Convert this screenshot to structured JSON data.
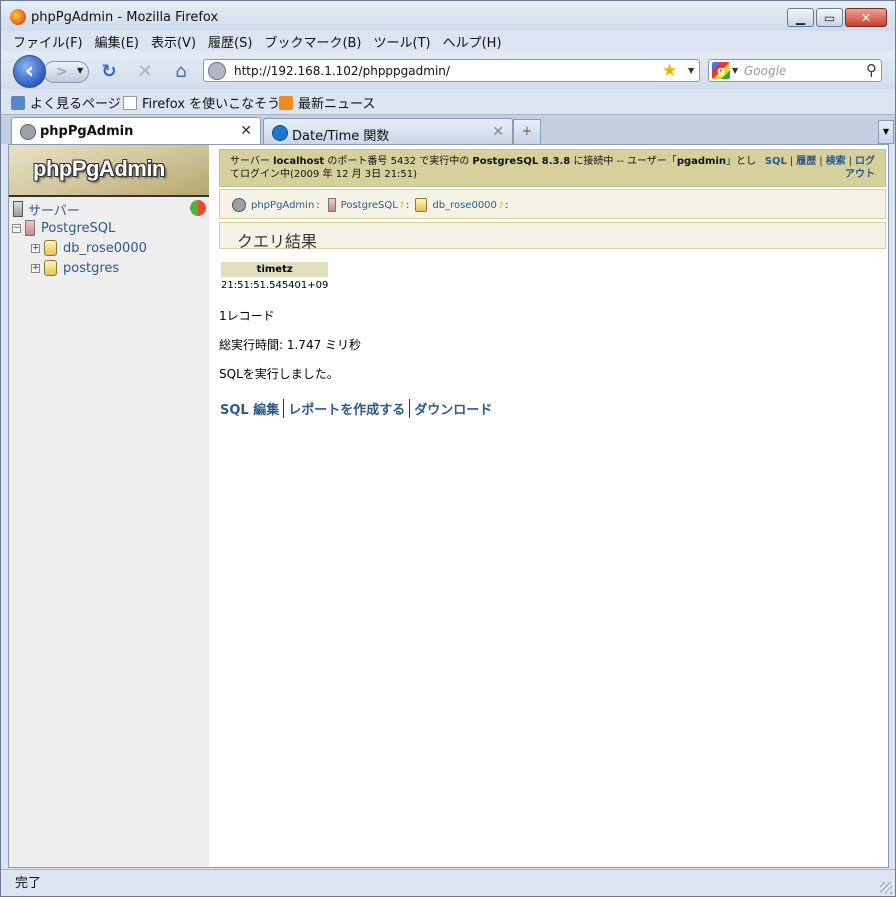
{
  "window": {
    "title": "phpPgAdmin - Mozilla Firefox"
  },
  "menu": [
    "ファイル(F)",
    "編集(E)",
    "表示(V)",
    "履歴(S)",
    "ブックマーク(B)",
    "ツール(T)",
    "ヘルプ(H)"
  ],
  "navigation": {
    "url": "http://192.168.1.102/phpppgadmin/",
    "search_placeholder": "Google"
  },
  "bookmarks": [
    "よく見るページ",
    "Firefox を使いこなそう",
    "最新ニュース"
  ],
  "tabs": [
    {
      "label": "phpPgAdmin",
      "active": true
    },
    {
      "label": "Date/Time 関数",
      "active": false
    }
  ],
  "sidebar": {
    "logo": "phpPgAdmin",
    "servers_label": "サーバー",
    "server_name": "PostgreSQL",
    "databases": [
      "db_rose0000",
      "postgres"
    ]
  },
  "infobar": {
    "text_prefix": "サーバー",
    "host": "localhost",
    "text_mid1": "のポート番号 5432 で実行中の",
    "product": "PostgreSQL 8.3.8",
    "text_mid2": "に接続中 -- ユーザー「",
    "user": "pgadmin",
    "text_suffix": "」としてログイン中(2009 年 12 月 3日 21:51)",
    "links": [
      "SQL",
      "履歴",
      "検索",
      "ログ",
      "アウト"
    ]
  },
  "trail": {
    "root": "phpPgAdmin",
    "server": "PostgreSQL",
    "database": "db_rose0000",
    "help_mark": "?",
    "sep": ":"
  },
  "page": {
    "title": "クエリ結果",
    "table": {
      "columns": [
        "timetz"
      ],
      "rows": [
        [
          "21:51:51.545401+09"
        ]
      ]
    },
    "record_count": "1レコード",
    "exec_time": "総実行時間: 1.747 ミリ秒",
    "message": "SQLを実行しました。",
    "actions": [
      "SQL 編集",
      "レポートを作成する",
      "ダウンロード"
    ]
  },
  "status": {
    "text": "完了"
  }
}
